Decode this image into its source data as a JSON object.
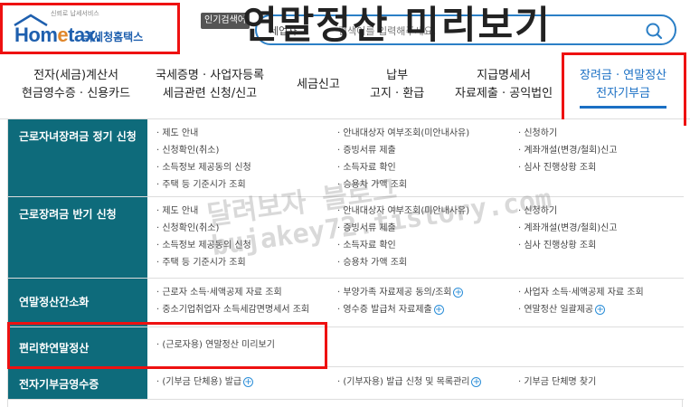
{
  "header": {
    "slogan": "신뢰로 납세서비스",
    "brand_prefix": "Hom",
    "brand_e": "e",
    "brand_suffix": "tax.",
    "site_name": "국세청홈택스",
    "popular_tag": "인기검색어",
    "search_type": "세업자",
    "search_placeholder": "검색어를 입력해주세요.",
    "overlay_title": "연말정산 미리보기"
  },
  "nav": {
    "items": [
      {
        "line1": "전자(세금)계산서",
        "line2": "현금영수증 · 신용카드"
      },
      {
        "line1": "국세증명 · 사업자등록",
        "line2": "세금관련 신청/신고"
      },
      {
        "line1": "세금신고",
        "line2": ""
      },
      {
        "line1": "납부",
        "line2": "고지 · 환급"
      },
      {
        "line1": "지급명세서",
        "line2": "자료제출 · 공익법인"
      },
      {
        "line1": "장려금 · 연말정산",
        "line2": "전자기부금"
      }
    ]
  },
  "sections": [
    {
      "label": "근로자녀장려금 정기 신청",
      "col1": [
        "· 제도 안내",
        "· 신청확인(취소)",
        "· 소득정보 제공동의 신청",
        "· 주택 등 기준시가 조회"
      ],
      "col2": [
        "· 안내대상자 여부조회(미안내사유)",
        "· 증빙서류 제출",
        "· 소득자료 확인",
        "· 승용차 가액 조회"
      ],
      "col3": [
        "· 신청하기",
        "· 계좌개설(변경/철회)신고",
        "· 심사 진행상황 조회"
      ]
    },
    {
      "label": "근로장려금 반기 신청",
      "col1": [
        "· 제도 안내",
        "· 신청확인(취소)",
        "· 소득정보 제공동의 신청",
        "· 주택 등 기준시가 조회"
      ],
      "col2": [
        "· 안내대상자 여부조회(미안내사유)",
        "· 증빙서류 제출",
        "· 소득자료 확인",
        "· 승용차 가액 조회"
      ],
      "col3": [
        "· 신청하기",
        "· 계좌개설(변경/철회)신고",
        "· 심사 진행상황 조회"
      ]
    },
    {
      "label": "연말정산간소화",
      "col1": [
        "· 근로자 소득·세액공제 자료 조회",
        "· 중소기업취업자 소득세감면명세서 조회"
      ],
      "col2": [
        "· 부양가족 자료제공 동의/조회",
        "· 영수증 발급처 자료제출"
      ],
      "col3": [
        "· 사업자 소득·세액공제 자료 조회",
        "· 연말정산 일괄제공"
      ]
    },
    {
      "label": "편리한연말정산",
      "col1": [
        "· (근로자용) 연말정산 미리보기"
      ],
      "col2": [],
      "col3": []
    },
    {
      "label": "전자기부금영수증",
      "col1": [
        "· (기부금 단체용) 발급"
      ],
      "col2": [
        "· (기부자용) 발급 신청 및 목록관리"
      ],
      "col3": [
        "· 기부금 단체명 찾기"
      ]
    }
  ],
  "watermark": {
    "line1": "달려보자 블로그",
    "line2": "bujakey72.tistory.com"
  },
  "colors": {
    "brand": "#1e5fae",
    "accent": "#e0872b",
    "teal": "#0e6b7b",
    "highlight": "#e11111",
    "nav_active": "#1a6fc4"
  }
}
